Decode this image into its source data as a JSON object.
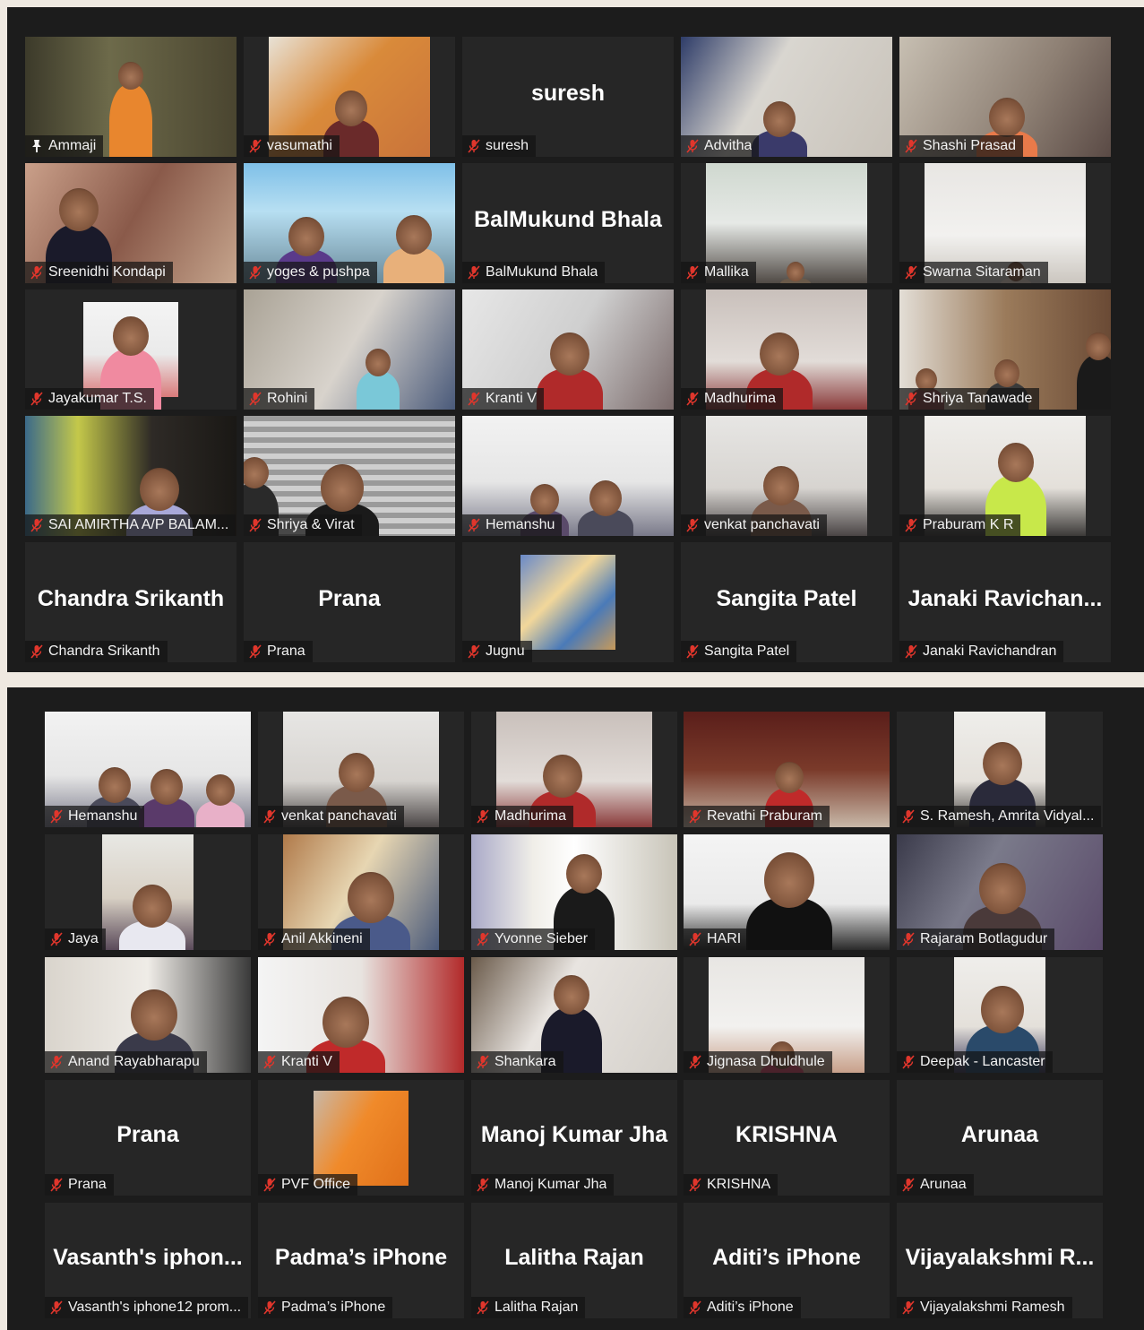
{
  "colors": {
    "panel_bg": "#1c1c1c",
    "tile_bg": "#262626",
    "active_border": "#cfe15a",
    "muted_icon": "#e0362c",
    "text": "#ffffff"
  },
  "screen1": {
    "tiles": [
      {
        "label": "Ammaji",
        "center": "",
        "icon": "pin-icon",
        "active": true
      },
      {
        "label": "vasumathi",
        "center": "",
        "icon": "mic-muted-icon"
      },
      {
        "label": "suresh",
        "center": "suresh",
        "icon": "mic-muted-icon"
      },
      {
        "label": "Advitha",
        "center": "",
        "icon": "mic-muted-icon"
      },
      {
        "label": "Shashi Prasad",
        "center": "",
        "icon": "mic-muted-icon"
      },
      {
        "label": "Sreenidhi Kondapi",
        "center": "",
        "icon": "mic-muted-icon"
      },
      {
        "label": "yoges & pushpa",
        "center": "",
        "icon": "mic-muted-icon"
      },
      {
        "label": "BalMukund Bhala",
        "center": "BalMukund Bhala",
        "icon": "mic-muted-icon"
      },
      {
        "label": "Mallika",
        "center": "",
        "icon": "mic-muted-icon"
      },
      {
        "label": "Swarna Sitaraman",
        "center": "",
        "icon": "mic-muted-icon"
      },
      {
        "label": "Jayakumar T.S.",
        "center": "",
        "icon": "mic-muted-icon"
      },
      {
        "label": "Rohini",
        "center": "",
        "icon": "mic-muted-icon"
      },
      {
        "label": "Kranti V",
        "center": "",
        "icon": "mic-muted-icon"
      },
      {
        "label": "Madhurima",
        "center": "",
        "icon": "mic-muted-icon"
      },
      {
        "label": "Shriya Tanawade",
        "center": "",
        "icon": "mic-muted-icon"
      },
      {
        "label": "SAI AMIRTHA A/P BALAM...",
        "center": "",
        "icon": "mic-muted-icon"
      },
      {
        "label": "Shriya & Virat",
        "center": "",
        "icon": "mic-muted-icon"
      },
      {
        "label": "Hemanshu",
        "center": "",
        "icon": "mic-muted-icon"
      },
      {
        "label": "venkat panchavati",
        "center": "",
        "icon": "mic-muted-icon"
      },
      {
        "label": "Praburam K R",
        "center": "",
        "icon": "mic-muted-icon"
      },
      {
        "label": "Chandra Srikanth",
        "center": "Chandra Srikanth",
        "icon": "mic-muted-icon"
      },
      {
        "label": "Prana",
        "center": "Prana",
        "icon": "mic-muted-icon"
      },
      {
        "label": "Jugnu",
        "center": "",
        "icon": "mic-muted-icon"
      },
      {
        "label": "Sangita Patel",
        "center": "Sangita Patel",
        "icon": "mic-muted-icon"
      },
      {
        "label": "Janaki Ravichandran",
        "center": "Janaki  Ravichan...",
        "icon": "mic-muted-icon"
      }
    ]
  },
  "screen2": {
    "tiles": [
      {
        "label": "Hemanshu",
        "center": "",
        "icon": "mic-muted-icon"
      },
      {
        "label": "venkat panchavati",
        "center": "",
        "icon": "mic-muted-icon"
      },
      {
        "label": "Madhurima",
        "center": "",
        "icon": "mic-muted-icon"
      },
      {
        "label": "Revathi Praburam",
        "center": "",
        "icon": "mic-muted-icon"
      },
      {
        "label": "S. Ramesh, Amrita Vidyal...",
        "center": "",
        "icon": "mic-muted-icon"
      },
      {
        "label": "Jaya",
        "center": "",
        "icon": "mic-muted-icon"
      },
      {
        "label": "Anil Akkineni",
        "center": "",
        "icon": "mic-muted-icon"
      },
      {
        "label": "Yvonne Sieber",
        "center": "",
        "icon": "mic-muted-icon"
      },
      {
        "label": "HARI",
        "center": "",
        "icon": "mic-muted-icon"
      },
      {
        "label": "Rajaram Botlagudur",
        "center": "",
        "icon": "mic-muted-icon"
      },
      {
        "label": "Anand Rayabharapu",
        "center": "",
        "icon": "mic-muted-icon"
      },
      {
        "label": "Kranti V",
        "center": "",
        "icon": "mic-muted-icon"
      },
      {
        "label": "Shankara",
        "center": "",
        "icon": "mic-muted-icon"
      },
      {
        "label": "Jignasa Dhuldhule",
        "center": "",
        "icon": "mic-muted-icon"
      },
      {
        "label": "Deepak - Lancaster",
        "center": "",
        "icon": "mic-muted-icon"
      },
      {
        "label": "Prana",
        "center": "Prana",
        "icon": "mic-muted-icon"
      },
      {
        "label": "PVF Office",
        "center": "",
        "icon": "mic-muted-icon"
      },
      {
        "label": "Manoj Kumar Jha",
        "center": "Manoj Kumar Jha",
        "icon": "mic-muted-icon"
      },
      {
        "label": "KRISHNA",
        "center": "KRISHNA",
        "icon": "mic-muted-icon"
      },
      {
        "label": "Arunaa",
        "center": "Arunaa",
        "icon": "mic-muted-icon"
      },
      {
        "label": "Vasanth's iphone12 prom...",
        "center": "Vasanth's  iphon...",
        "icon": "mic-muted-icon"
      },
      {
        "label": "Padma’s iPhone",
        "center": "Padma’s iPhone",
        "icon": "mic-muted-icon"
      },
      {
        "label": "Lalitha Rajan",
        "center": "Lalitha Rajan",
        "icon": "mic-muted-icon"
      },
      {
        "label": "Aditi’s iPhone",
        "center": "Aditi’s iPhone",
        "icon": "mic-muted-icon"
      },
      {
        "label": "Vijayalakshmi Ramesh",
        "center": "Vijayalakshmi  R...",
        "icon": "mic-muted-icon"
      }
    ]
  }
}
